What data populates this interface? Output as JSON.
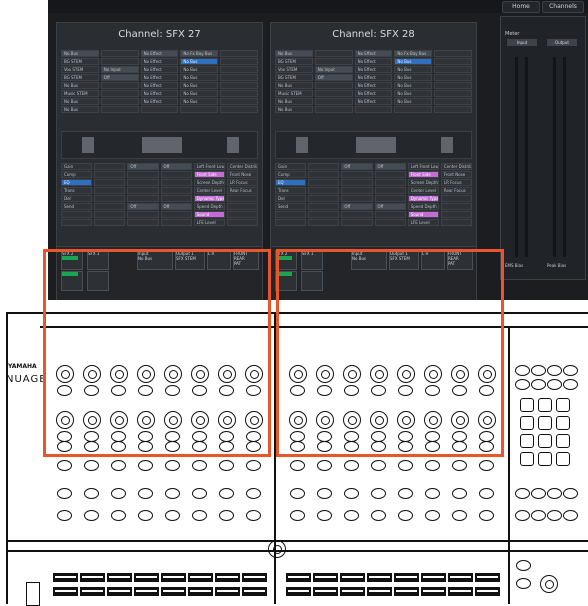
{
  "top_tabs": [
    "Home",
    "Channels"
  ],
  "panels": [
    {
      "title": "Channel: SFX 27",
      "rows": [
        [
          "No Bus",
          "",
          "No Effect",
          "No Fx Bay Bus",
          ""
        ],
        [
          "BG STEM",
          "",
          "No Effect",
          "No Bus",
          ""
        ],
        [
          "Vox STEM",
          "No Input",
          "No Effect",
          "No Bus",
          ""
        ],
        [
          "BG STEM",
          "Off",
          "No Effect",
          "No Bus",
          ""
        ],
        [
          "No Bus",
          "",
          "No Effect",
          "No Bus",
          ""
        ],
        [
          "Music STEM",
          "",
          "No Effect",
          "No Bus",
          ""
        ],
        [
          "No Bus",
          "",
          "No Effect",
          "No Bus",
          ""
        ],
        [
          "No Bus",
          "",
          "",
          "",
          ""
        ]
      ],
      "lower_rows": [
        [
          "Gain",
          "",
          "Off",
          "Off",
          "Left Front Low",
          "Center Distribution"
        ],
        [
          "Comp",
          "",
          "",
          "",
          "Front Side",
          "Front Nose"
        ],
        [
          "EQ",
          "",
          "",
          "",
          "Screen Depth",
          "LR Focus"
        ],
        [
          "Trans",
          "",
          "",
          "",
          "Center Level",
          "Rear Focus"
        ],
        [
          "Del",
          "",
          "",
          "",
          "Dynamic Type",
          ""
        ],
        [
          "Send",
          "",
          "Off",
          "Off",
          "Speed Depth",
          ""
        ],
        [
          "",
          "",
          "",
          "",
          "Sound",
          ""
        ],
        [
          "",
          "",
          "",
          "",
          "LFE Level",
          ""
        ]
      ]
    },
    {
      "title": "Channel: SFX 28",
      "rows": [
        [
          "No Bus",
          "",
          "No Effect",
          "No Fx Bay Bus",
          ""
        ],
        [
          "BG STEM",
          "",
          "No Effect",
          "No Bus",
          ""
        ],
        [
          "Vox STEM",
          "No Input",
          "No Effect",
          "No Bus",
          ""
        ],
        [
          "BG STEM",
          "Off",
          "No Effect",
          "No Bus",
          ""
        ],
        [
          "No Bus",
          "",
          "No Effect",
          "No Bus",
          ""
        ],
        [
          "Music STEM",
          "",
          "No Effect",
          "No Bus",
          ""
        ],
        [
          "No Bus",
          "",
          "No Effect",
          "No Bus",
          ""
        ],
        [
          "No Bus",
          "",
          "",
          "",
          ""
        ]
      ],
      "lower_rows": [
        [
          "Gain",
          "",
          "Off",
          "Off",
          "Left Front Low",
          "Center Distribution"
        ],
        [
          "Comp",
          "",
          "",
          "",
          "Front Side",
          "Front Nose"
        ],
        [
          "EQ",
          "",
          "",
          "",
          "Screen Depth",
          "LR Focus"
        ],
        [
          "Trans",
          "",
          "",
          "",
          "Center Level",
          "Rear Focus"
        ],
        [
          "Del",
          "",
          "",
          "",
          "Dynamic Type",
          ""
        ],
        [
          "Send",
          "",
          "Off",
          "Off",
          "Speed Depth",
          ""
        ],
        [
          "",
          "",
          "",
          "",
          "Sound",
          ""
        ],
        [
          "",
          "",
          "",
          "",
          "LFE Level",
          ""
        ]
      ]
    }
  ],
  "strip_left": {
    "labels": [
      "SFX 2",
      "SFX 1",
      "Input",
      "Output 1",
      "L R",
      "FRONT REAR"
    ],
    "sub": [
      "No Bus",
      "SFX STEM",
      "PAT"
    ]
  },
  "strip_right": {
    "labels": [
      "SFX 2",
      "SFX 1",
      "Input",
      "Output 1",
      "L R",
      "FRONT REAR"
    ],
    "sub": [
      "No Bus",
      "SFX STEM",
      "PAT"
    ]
  },
  "meter": {
    "header": "Meter",
    "buttons": [
      "Input",
      "Output"
    ],
    "footer": [
      "EMS Bias",
      "Peak Bias"
    ]
  },
  "brand": {
    "top": "YAMAHA",
    "bottom": "NUAGE"
  }
}
